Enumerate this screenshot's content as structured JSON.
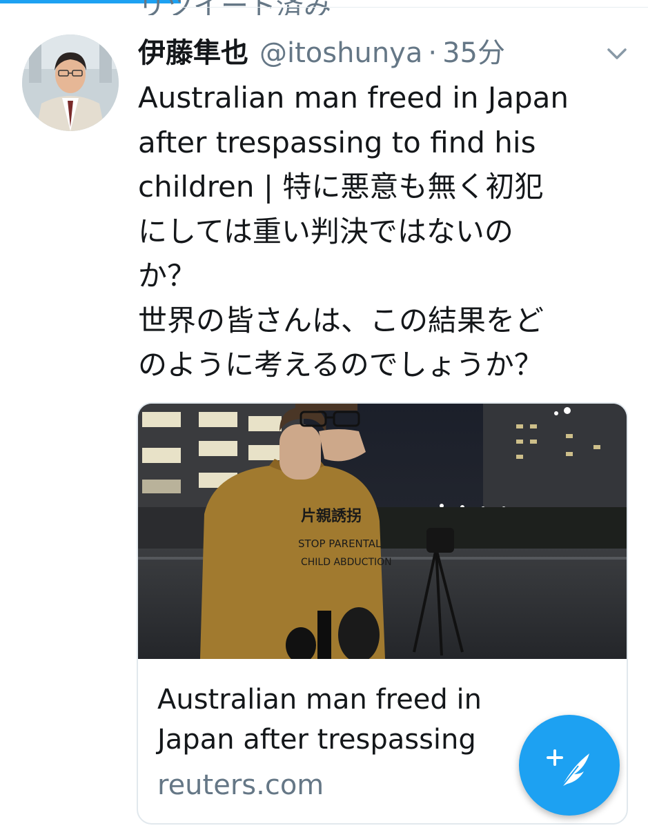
{
  "banner": {
    "partial_text": "リツイート済み"
  },
  "tweet": {
    "author_name": "伊藤隼也",
    "handle": "@itoshunya",
    "separator": "·",
    "time": "35分",
    "lines": [
      "Australian man freed in Japan",
      "after trespassing to find his",
      "children | 特に悪意も無く初犯",
      "にしては重い判決ではないの",
      "か？",
      "世界の皆さんは、この結果をど",
      "のように考えるのでしょうか？"
    ]
  },
  "card": {
    "shirt_text": [
      "片親誘拐",
      "STOP PARENTAL",
      "CHILD ABDUCTION"
    ],
    "title_lines": [
      "Australian man freed in",
      "Japan after trespassing"
    ],
    "domain": "reuters.com"
  },
  "icons": {
    "avatar": "avatar",
    "caret": "chevron-down-icon",
    "compose": "compose-tweet-icon"
  },
  "colors": {
    "accent": "#1da1f2",
    "secondary_text": "#657786",
    "primary_text": "#14171a",
    "card_border": "#e1e8ed"
  }
}
